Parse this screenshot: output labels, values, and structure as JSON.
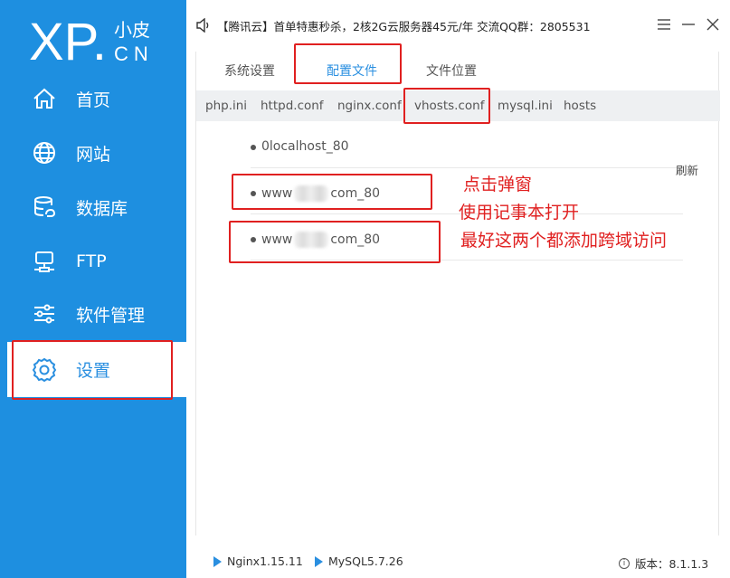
{
  "logo": {
    "main": "XP.",
    "top": "小皮",
    "bottom": "CN"
  },
  "sidebar": {
    "items": [
      {
        "id": "home",
        "label": "首页",
        "icon": "home-icon"
      },
      {
        "id": "website",
        "label": "网站",
        "icon": "globe-icon"
      },
      {
        "id": "database",
        "label": "数据库",
        "icon": "database-icon"
      },
      {
        "id": "ftp",
        "label": "FTP",
        "icon": "ftp-server-icon"
      },
      {
        "id": "software",
        "label": "软件管理",
        "icon": "sliders-icon"
      },
      {
        "id": "settings",
        "label": "设置",
        "icon": "gear-icon",
        "active": true
      }
    ]
  },
  "topbar": {
    "ad_text": "【腾讯云】首单特惠秒杀，2核2G云服务器45元/年 交流QQ群：2805531",
    "menu_icon": "hamburger-icon",
    "minimize_icon": "minimize-icon",
    "close_icon": "close-icon"
  },
  "tabs": [
    {
      "label": "系统设置"
    },
    {
      "label": "配置文件",
      "active": true
    },
    {
      "label": "文件位置"
    }
  ],
  "subtabs": [
    {
      "label": "php.ini"
    },
    {
      "label": "httpd.conf"
    },
    {
      "label": "nginx.conf"
    },
    {
      "label": "vhosts.conf",
      "active": true
    },
    {
      "label": "mysql.ini"
    },
    {
      "label": "hosts"
    }
  ],
  "vhosts": [
    {
      "prefix": "0localhost_80",
      "suffix": "",
      "redacted": false
    },
    {
      "prefix": "www",
      "suffix": "com_80",
      "redacted": true
    },
    {
      "prefix": "www",
      "suffix": "com_80",
      "redacted": true
    }
  ],
  "refresh_label": "刷新",
  "annotations": {
    "line1": "点击弹窗",
    "line2": "使用记事本打开",
    "line3": "最好这两个都添加跨域访问"
  },
  "status": {
    "nginx": "Nginx1.15.11",
    "mysql": "MySQL5.7.26",
    "version": "版本：8.1.1.3"
  },
  "colors": {
    "sidebar": "#1e8fe0",
    "accent": "#2a8fe0",
    "annotation": "#e02020"
  }
}
